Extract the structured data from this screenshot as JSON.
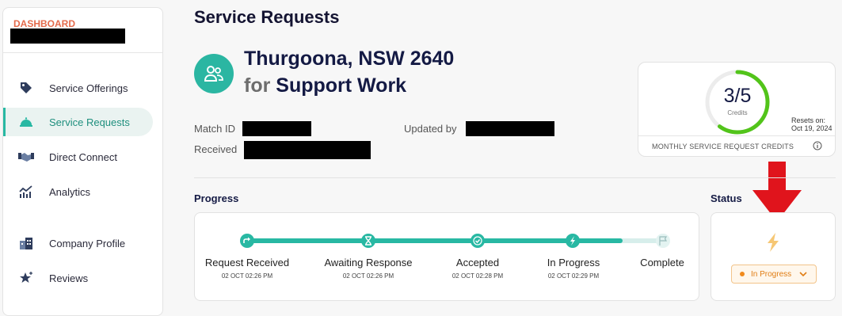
{
  "sidebar": {
    "dashboard_label": "DASHBOARD",
    "items": [
      {
        "label": "Service Offerings",
        "icon": "tag-icon"
      },
      {
        "label": "Service Requests",
        "icon": "bell-icon"
      },
      {
        "label": "Direct Connect",
        "icon": "handshake-icon"
      },
      {
        "label": "Analytics",
        "icon": "chart-icon"
      },
      {
        "label": "Company Profile",
        "icon": "building-icon"
      },
      {
        "label": "Reviews",
        "icon": "star-icon"
      }
    ]
  },
  "page": {
    "title": "Service Requests",
    "location": "Thurgoona, NSW 2640",
    "for_word": "for",
    "service": "Support Work"
  },
  "meta": {
    "match_id_label": "Match ID",
    "updated_by_label": "Updated by",
    "received_label": "Received"
  },
  "credits": {
    "value": "3/5",
    "label": "Credits",
    "used_fraction": 0.6,
    "resets_label": "Resets on:",
    "resets_date": "Oct 19, 2024",
    "footer": "MONTHLY SERVICE REQUEST CREDITS"
  },
  "progress": {
    "title": "Progress",
    "steps": [
      {
        "label": "Request Received",
        "date": "02 OCT 02:26 PM",
        "icon": "forward-arrow-icon"
      },
      {
        "label": "Awaiting Response",
        "date": "02 OCT 02:26 PM",
        "icon": "hourglass-icon"
      },
      {
        "label": "Accepted",
        "date": "02 OCT 02:28 PM",
        "icon": "check-icon"
      },
      {
        "label": "In Progress",
        "date": "02 OCT 02:29 PM",
        "icon": "lightning-icon"
      },
      {
        "label": "Complete",
        "date": "",
        "icon": "flag-icon"
      }
    ]
  },
  "status": {
    "title": "Status",
    "value": "In Progress",
    "icon": "lightning-icon"
  },
  "colors": {
    "accent": "#28b8a3",
    "dashboard": "#e46a4b",
    "annotation_arrow": "#e0141c",
    "status_orange": "#f08a1c"
  }
}
